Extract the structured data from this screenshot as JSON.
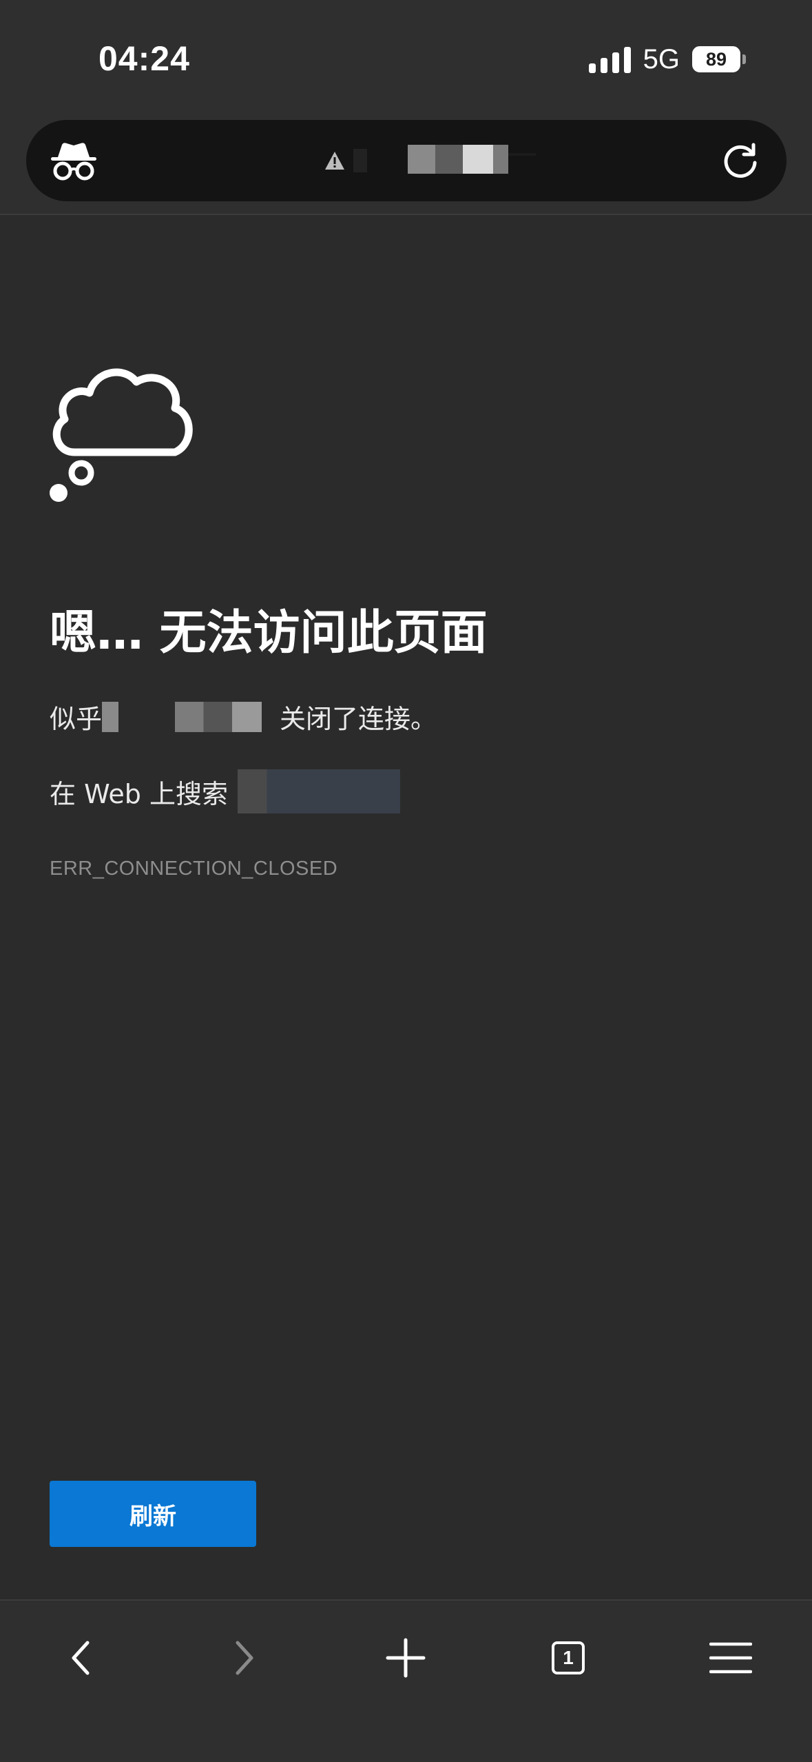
{
  "status_bar": {
    "time": "04:24",
    "network": "5G",
    "battery_level": "89",
    "signal_bars": 4
  },
  "address_bar": {
    "url_text": "",
    "mode_icon": "incognito-icon",
    "security_icon": "warning-icon",
    "action_icon": "reload-icon"
  },
  "error_page": {
    "icon": "cloud-thought-icon",
    "title": "嗯… 无法访问此页面",
    "message_prefix": "似乎",
    "message_suffix": "关闭了连接。",
    "search_prefix": "在 Web 上搜索",
    "error_code": "ERR_CONNECTION_CLOSED",
    "refresh_label": "刷新"
  },
  "toolbar": {
    "items": [
      "back",
      "forward",
      "new-tab",
      "tabs",
      "menu"
    ],
    "tab_count": "1"
  },
  "colors": {
    "background": "#2b2b2b",
    "bars": "#2f2f2f",
    "address_pill": "#141414",
    "accent_button": "#0a78d4",
    "error_code_text": "#8e8e8e"
  }
}
